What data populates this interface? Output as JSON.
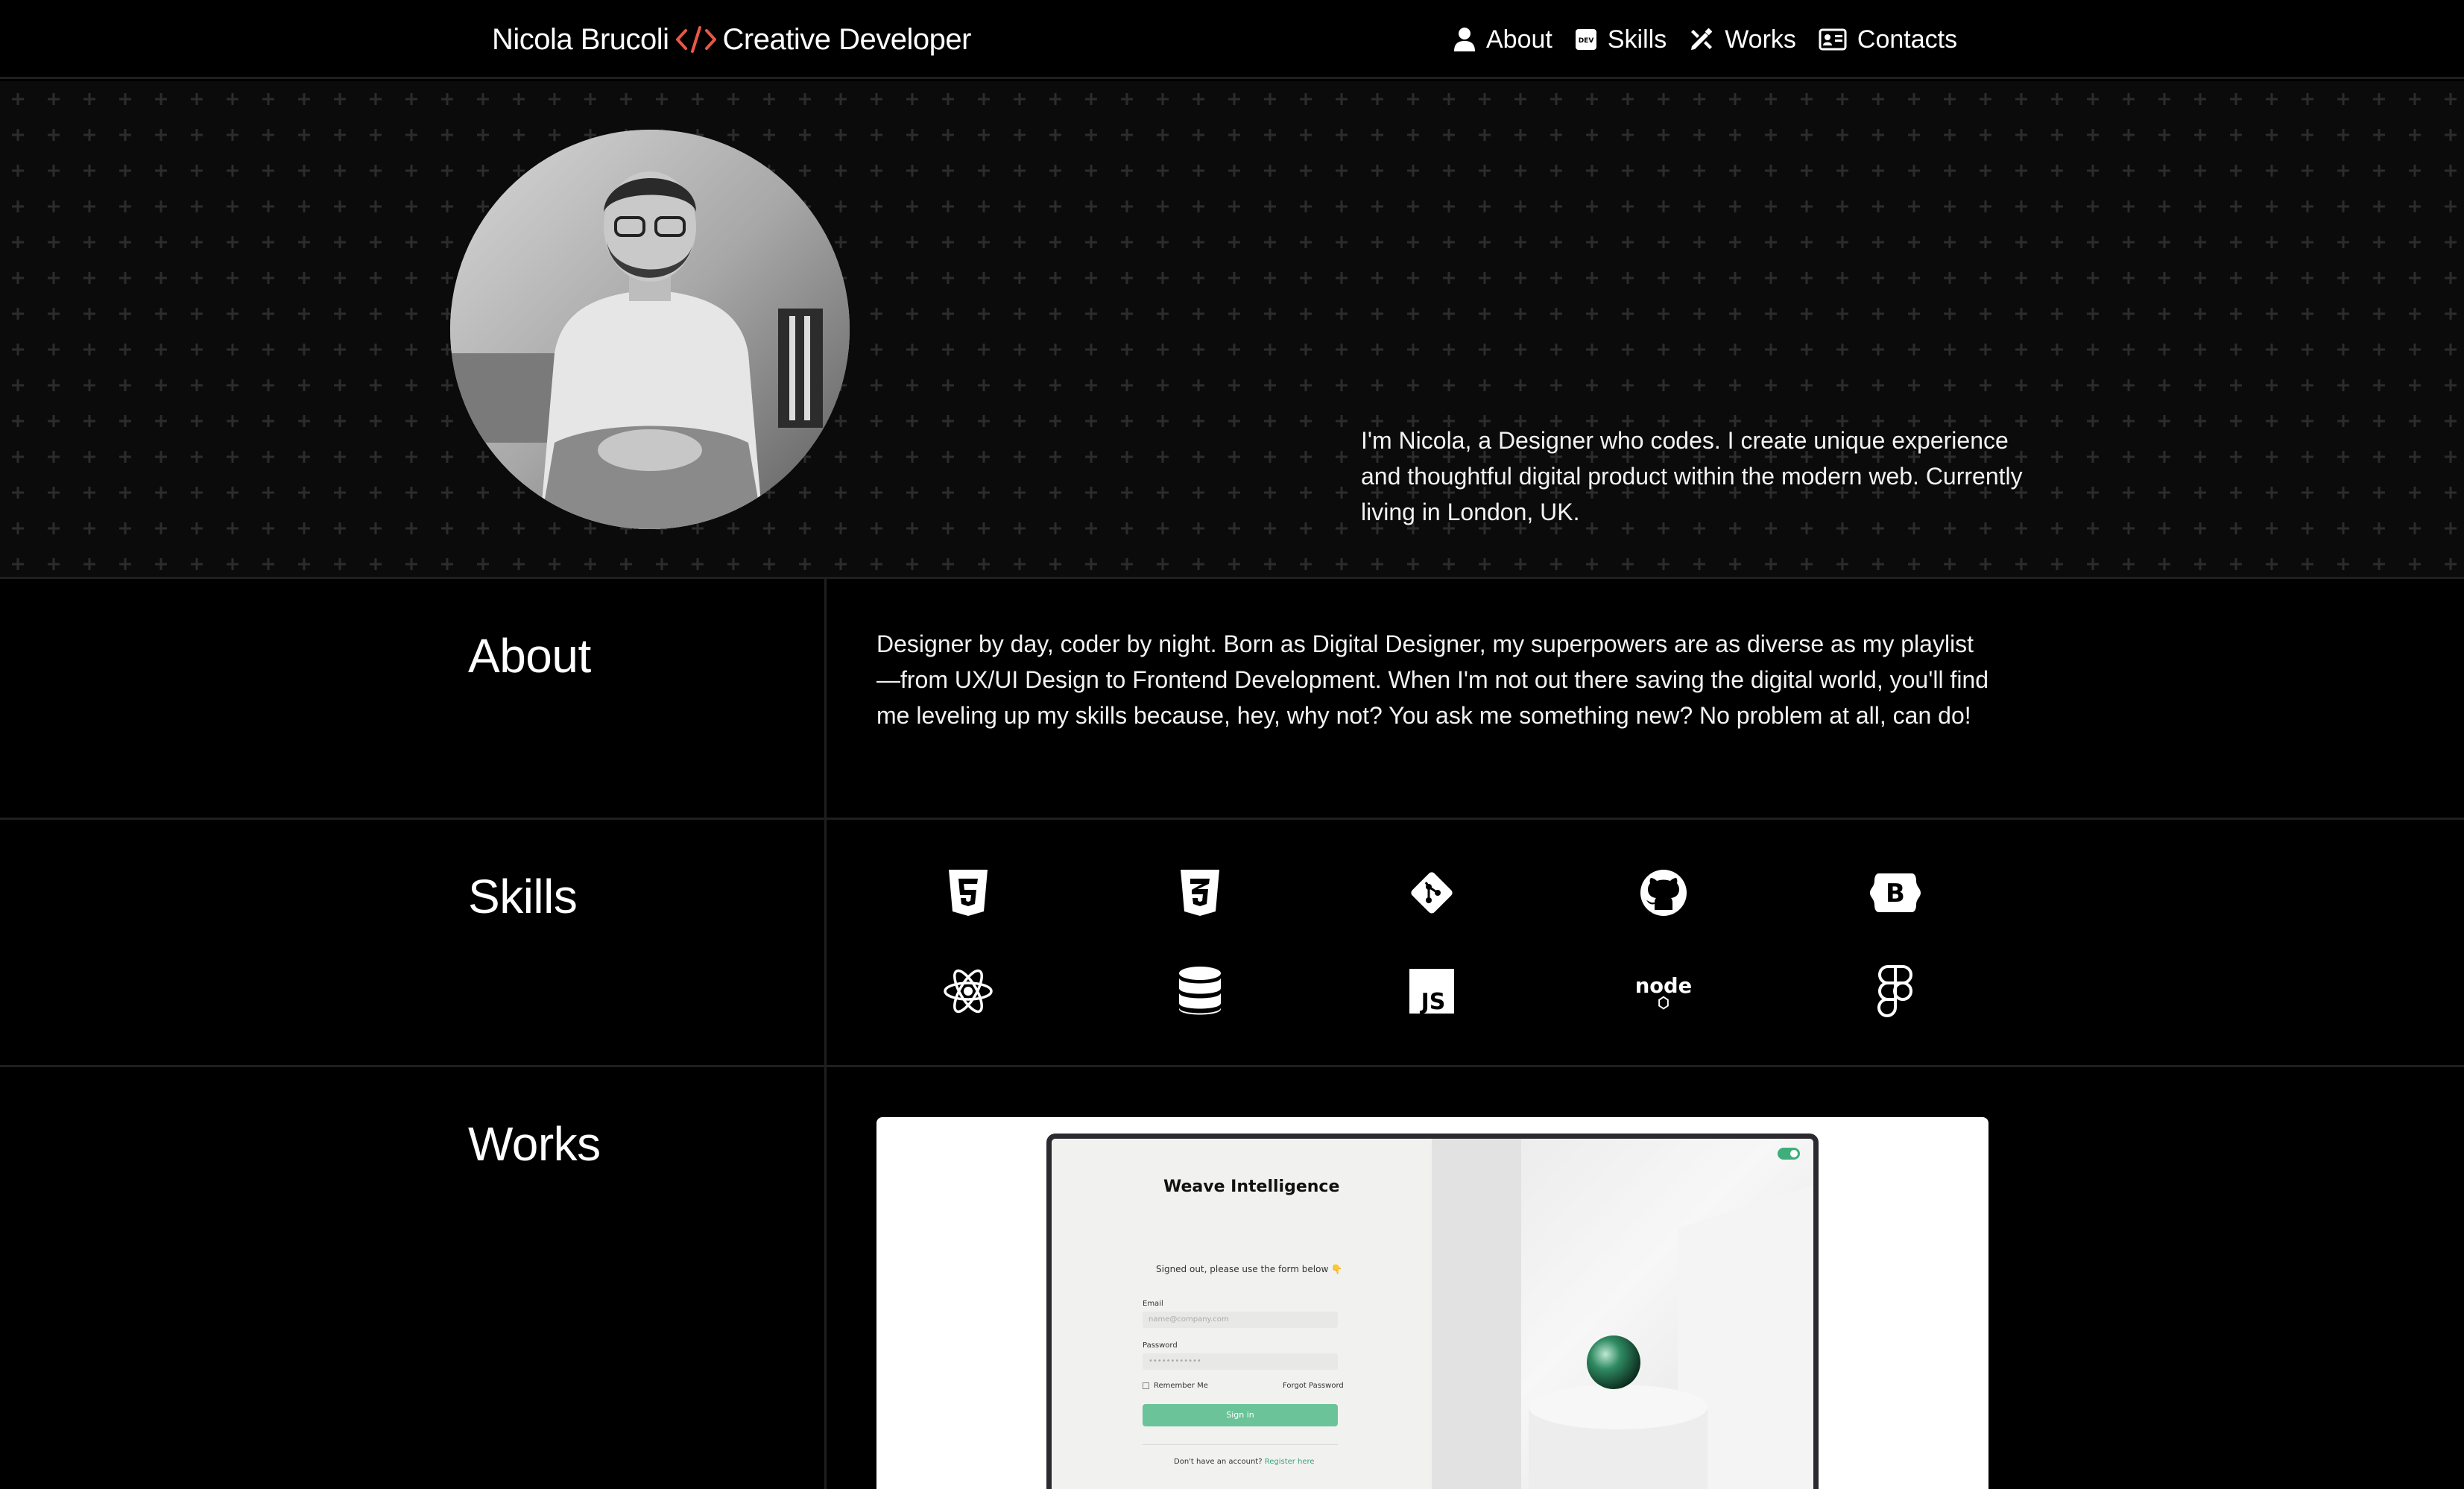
{
  "header": {
    "brand_name": "Nicola Brucoli",
    "brand_role": "Creative Developer",
    "brand_icon": "code-icon",
    "accent_color": "#e8574a"
  },
  "nav": [
    {
      "label": "About",
      "icon": "user-icon"
    },
    {
      "label": "Skills",
      "icon": "dev-icon"
    },
    {
      "label": "Works",
      "icon": "design-tools-icon"
    },
    {
      "label": "Contacts",
      "icon": "contact-card-icon"
    }
  ],
  "hero": {
    "intro": "I'm Nicola, a Designer who codes. I create unique experience and thoughtful digital product within the modern web. Currently living in London, UK."
  },
  "about": {
    "title": "About",
    "text": "Designer by day, coder by night. Born as Digital Designer, my superpowers are as diverse as my playlist—from UX/UI Design to Frontend Development. When I'm not out there saving the digital world, you'll find me leveling up my skills because, hey, why not? You ask me something new? No problem at all, can do!"
  },
  "skills": {
    "title": "Skills",
    "icons": [
      "html5-icon",
      "css3-icon",
      "git-icon",
      "github-icon",
      "bootstrap-icon",
      "react-icon",
      "database-icon",
      "javascript-icon",
      "nodejs-icon",
      "figma-icon"
    ],
    "js_label": "JS",
    "bootstrap_label": "B",
    "node_label": "node"
  },
  "works": {
    "title": "Works",
    "preview": {
      "app_title": "Weave Intelligence",
      "message": "Signed out, please use the form below 👇",
      "email_label": "Email",
      "email_placeholder": "name@company.com",
      "password_label": "Password",
      "password_placeholder": "••••••••••••",
      "remember_label": "Remember Me",
      "forgot_label": "Forgot Password",
      "signin_label": "Sign in",
      "footer_text": "Don't have an account?",
      "footer_link": "Register here"
    }
  }
}
